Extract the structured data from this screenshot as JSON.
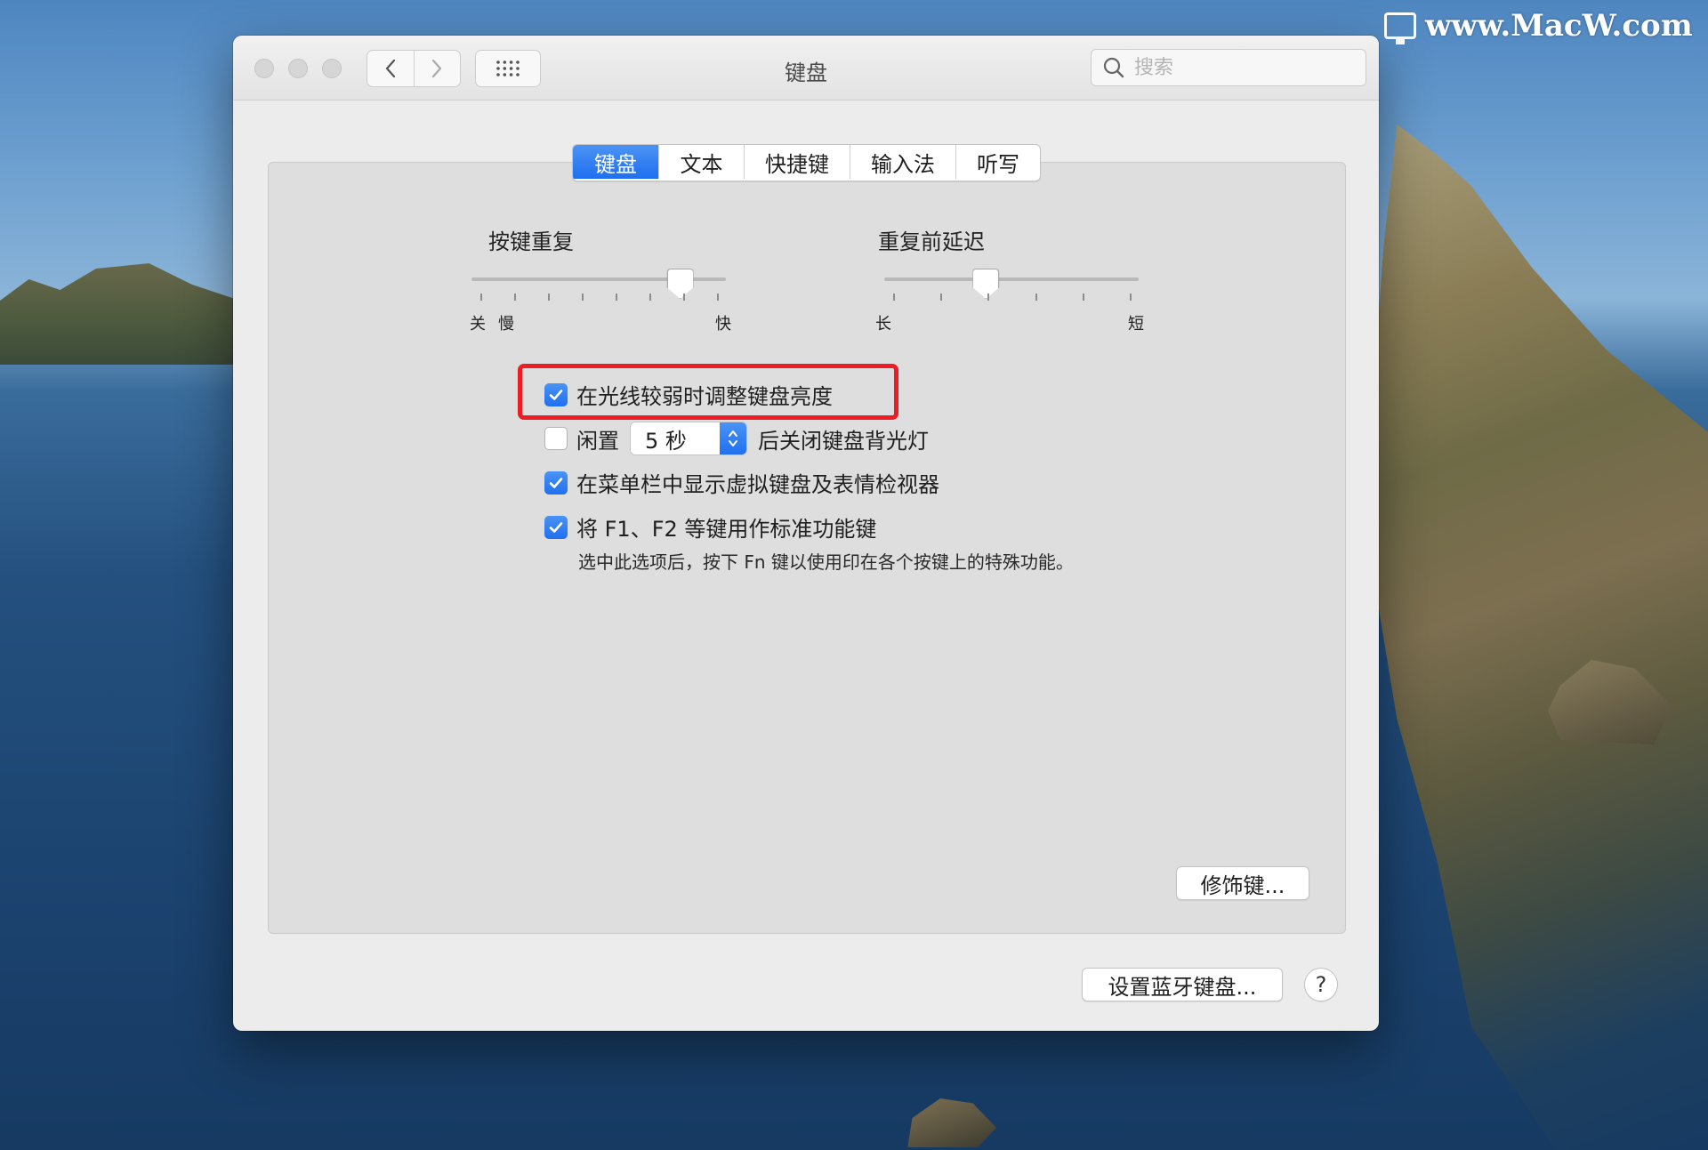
{
  "watermark": {
    "text": "www.MacW.com"
  },
  "window": {
    "title": "键盘",
    "search_placeholder": "搜索"
  },
  "tabs": [
    {
      "label": "键盘",
      "active": true
    },
    {
      "label": "文本",
      "active": false
    },
    {
      "label": "快捷键",
      "active": false
    },
    {
      "label": "输入法",
      "active": false
    },
    {
      "label": "听写",
      "active": false
    }
  ],
  "sliders": {
    "key_repeat": {
      "title": "按键重复",
      "label_off": "关",
      "label_slow": "慢",
      "label_fast": "快",
      "level_fraction": 0.82
    },
    "delay": {
      "title": "重复前延迟",
      "label_long": "长",
      "label_short": "短",
      "level_fraction": 0.4
    }
  },
  "options": {
    "adjust_brightness": {
      "label": "在光线较弱时调整键盘亮度",
      "checked": true
    },
    "idle_backlight": {
      "prefix": "闲置",
      "value": "5 秒",
      "suffix": "后关闭键盘背光灯",
      "checked": false
    },
    "show_viewer": {
      "label": "在菜单栏中显示虚拟键盘及表情检视器",
      "checked": true
    },
    "fn_keys": {
      "label": "将 F1、F2 等键用作标准功能键",
      "checked": true,
      "note": "选中此选项后，按下 Fn 键以使用印在各个按键上的特殊功能。"
    }
  },
  "buttons": {
    "modifier": "修饰键...",
    "bluetooth": "设置蓝牙键盘...",
    "help": "?"
  },
  "colors": {
    "accent": "#1f6ff0",
    "highlight": "#ee1d25"
  }
}
